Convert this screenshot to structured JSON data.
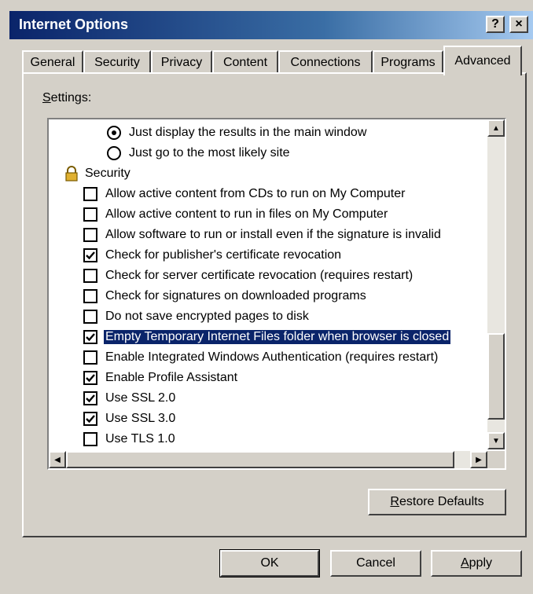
{
  "window": {
    "title": "Internet Options",
    "help_glyph": "?",
    "close_glyph": "×"
  },
  "tabs": [
    {
      "label": "General",
      "active": false
    },
    {
      "label": "Security",
      "active": false
    },
    {
      "label": "Privacy",
      "active": false
    },
    {
      "label": "Content",
      "active": false
    },
    {
      "label": "Connections",
      "active": false
    },
    {
      "label": "Programs",
      "active": false
    },
    {
      "label": "Advanced",
      "active": true
    }
  ],
  "settings": {
    "label_mnemonic": "S",
    "label_rest": "ettings:",
    "items": [
      {
        "type": "radio",
        "label": "Just display the results in the main window",
        "checked": true,
        "indent": 2
      },
      {
        "type": "radio",
        "label": "Just go to the most likely site",
        "checked": false,
        "indent": 2
      },
      {
        "type": "group",
        "label": "Security",
        "icon": "lock-icon"
      },
      {
        "type": "checkbox",
        "label": "Allow active content from CDs to run on My Computer",
        "checked": false
      },
      {
        "type": "checkbox",
        "label": "Allow active content to run in files on My Computer",
        "checked": false
      },
      {
        "type": "checkbox",
        "label": "Allow software to run or install even if the signature is invalid",
        "checked": false
      },
      {
        "type": "checkbox",
        "label": "Check for publisher's certificate revocation",
        "checked": true
      },
      {
        "type": "checkbox",
        "label": "Check for server certificate revocation (requires restart)",
        "checked": false
      },
      {
        "type": "checkbox",
        "label": "Check for signatures on downloaded programs",
        "checked": false
      },
      {
        "type": "checkbox",
        "label": "Do not save encrypted pages to disk",
        "checked": false
      },
      {
        "type": "checkbox",
        "label": "Empty Temporary Internet Files folder when browser is closed",
        "checked": true,
        "selected": true
      },
      {
        "type": "checkbox",
        "label": "Enable Integrated Windows Authentication (requires restart)",
        "checked": false
      },
      {
        "type": "checkbox",
        "label": "Enable Profile Assistant",
        "checked": true
      },
      {
        "type": "checkbox",
        "label": "Use SSL 2.0",
        "checked": true
      },
      {
        "type": "checkbox",
        "label": "Use SSL 3.0",
        "checked": true
      },
      {
        "type": "checkbox",
        "label": "Use TLS 1.0",
        "checked": false
      }
    ]
  },
  "buttons": {
    "restore_mnemonic": "R",
    "restore_rest": "estore Defaults",
    "ok": "OK",
    "cancel": "Cancel",
    "apply_mnemonic": "A",
    "apply_rest": "pply"
  },
  "colors": {
    "titlebar_start": "#0a246a",
    "selection": "#0a246a",
    "face": "#d4d0c8"
  }
}
